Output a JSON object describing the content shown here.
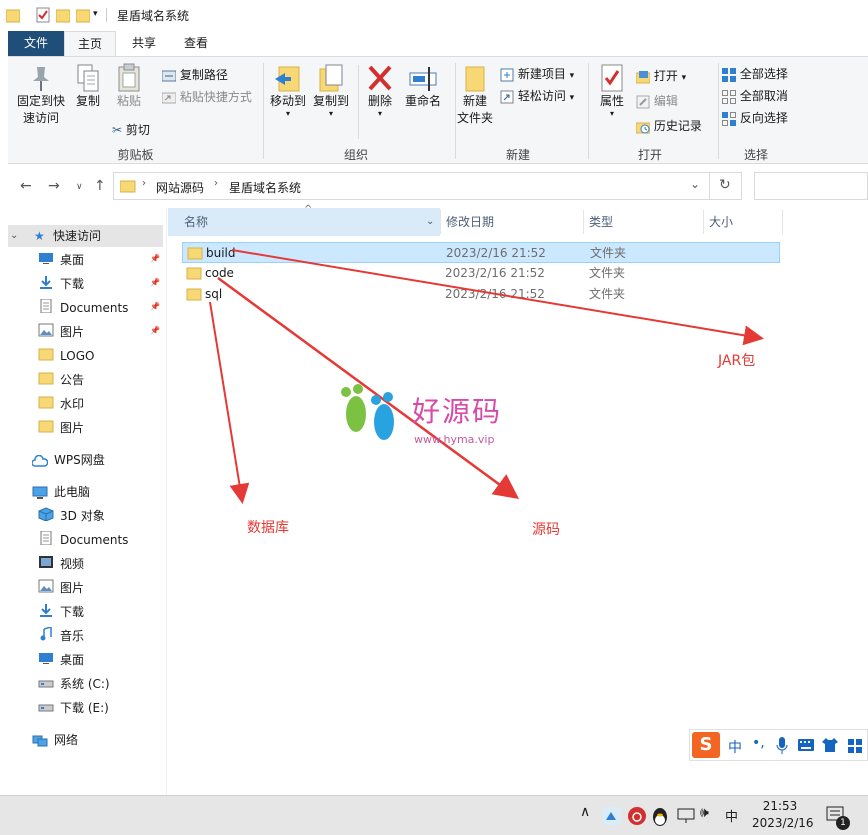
{
  "window": {
    "title": "星盾域名系统"
  },
  "ribbon_tabs": [
    "文件",
    "主页",
    "共享",
    "查看"
  ],
  "ribbon": {
    "clipboard": {
      "pin_label_1": "固定到快",
      "pin_label_2": "速访问",
      "copy": "复制",
      "paste": "粘贴",
      "copy_path": "复制路径",
      "paste_shortcut": "粘贴快捷方式",
      "cut": "剪切",
      "group": "剪贴板"
    },
    "organize": {
      "move_to": "移动到",
      "copy_to": "复制到",
      "delete": "删除",
      "rename": "重命名",
      "group": "组织"
    },
    "new": {
      "new_folder_1": "新建",
      "new_folder_2": "文件夹",
      "new_item": "新建项目",
      "easy_access": "轻松访问",
      "group": "新建"
    },
    "open": {
      "properties": "属性",
      "open": "打开",
      "edit": "编辑",
      "history": "历史记录",
      "group": "打开"
    },
    "select": {
      "select_all": "全部选择",
      "select_none": "全部取消",
      "invert": "反向选择",
      "group": "选择"
    }
  },
  "address": {
    "crumbs": [
      "网站源码",
      "星盾域名系统"
    ]
  },
  "nav": {
    "quick_access": "快速访问",
    "items": [
      {
        "label": "桌面",
        "icon": "desktop-icon",
        "pinned": true
      },
      {
        "label": "下载",
        "icon": "download-icon",
        "pinned": true
      },
      {
        "label": "Documents",
        "icon": "documents-icon",
        "pinned": true
      },
      {
        "label": "图片",
        "icon": "pictures-icon",
        "pinned": true
      },
      {
        "label": "LOGO",
        "icon": "folder-icon",
        "pinned": false
      },
      {
        "label": "公告",
        "icon": "folder-icon",
        "pinned": false
      },
      {
        "label": "水印",
        "icon": "folder-icon",
        "pinned": false
      },
      {
        "label": "图片",
        "icon": "folder-icon",
        "pinned": false
      }
    ],
    "wps": "WPS网盘",
    "this_pc": "此电脑",
    "pc_items": [
      {
        "label": "3D 对象",
        "icon": "3d-objects-icon"
      },
      {
        "label": "Documents",
        "icon": "documents-icon"
      },
      {
        "label": "视频",
        "icon": "videos-icon"
      },
      {
        "label": "图片",
        "icon": "pictures-icon"
      },
      {
        "label": "下载",
        "icon": "download-icon"
      },
      {
        "label": "音乐",
        "icon": "music-icon"
      },
      {
        "label": "桌面",
        "icon": "desktop-icon"
      },
      {
        "label": "系统 (C:)",
        "icon": "drive-icon"
      },
      {
        "label": "下载 (E:)",
        "icon": "drive-icon"
      }
    ],
    "network": "网络"
  },
  "columns": {
    "name": "名称",
    "modified": "修改日期",
    "type": "类型",
    "size": "大小"
  },
  "files": [
    {
      "name": "build",
      "modified": "2023/2/16 21:52",
      "type": "文件夹",
      "selected": true
    },
    {
      "name": "code",
      "modified": "2023/2/16 21:52",
      "type": "文件夹",
      "selected": false
    },
    {
      "name": "sql",
      "modified": "2023/2/16 21:52",
      "type": "文件夹",
      "selected": false
    }
  ],
  "annotations": {
    "jar": "JAR包",
    "database": "数据库",
    "source": "源码",
    "watermark_name": "好源码",
    "watermark_url": "www.hyma.vip"
  },
  "ime": {
    "mode": "中"
  },
  "taskbar": {
    "ime_lang": "中",
    "time": "21:53",
    "date": "2023/2/16",
    "notification_count": "1"
  },
  "colors": {
    "annotation": "#e53935",
    "selection": "#cce8ff",
    "folder": "#f8d775",
    "file_tab": "#1f4e79"
  }
}
